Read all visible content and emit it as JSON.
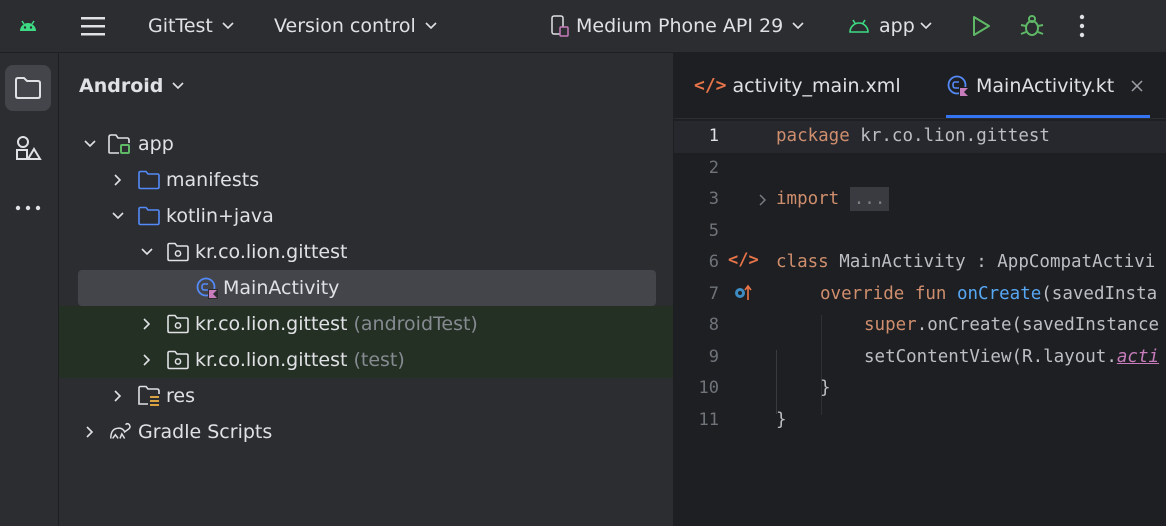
{
  "toolbar": {
    "project_name": "GitTest",
    "vcs_label": "Version control",
    "device": "Medium Phone API 29",
    "run_config": "app"
  },
  "colors": {
    "accent": "#3574f0",
    "run_green": "#5fb865",
    "android_green": "#3ddc84",
    "selection": "#43454a",
    "test_bg": "#253024"
  },
  "project_panel": {
    "view_mode": "Android",
    "tree": [
      {
        "label": "app",
        "suffix": "",
        "icon": "module-icon",
        "depth": 0,
        "expanded": true
      },
      {
        "label": "manifests",
        "suffix": "",
        "icon": "folder-icon",
        "depth": 1,
        "expanded": false
      },
      {
        "label": "kotlin+java",
        "suffix": "",
        "icon": "folder-icon",
        "depth": 1,
        "expanded": true
      },
      {
        "label": "kr.co.lion.gittest",
        "suffix": "",
        "icon": "package-icon",
        "depth": 2,
        "expanded": true
      },
      {
        "label": "MainActivity",
        "suffix": "",
        "icon": "kotlin-class-icon",
        "depth": 3,
        "selected": true
      },
      {
        "label": "kr.co.lion.gittest",
        "suffix": "(androidTest)",
        "icon": "package-icon",
        "depth": 2,
        "expanded": false
      },
      {
        "label": "kr.co.lion.gittest",
        "suffix": "(test)",
        "icon": "package-icon",
        "depth": 2,
        "expanded": false
      },
      {
        "label": "res",
        "suffix": "",
        "icon": "res-folder-icon",
        "depth": 1,
        "expanded": false
      },
      {
        "label": "Gradle Scripts",
        "suffix": "",
        "icon": "gradle-icon",
        "depth": 0,
        "expanded": false
      }
    ]
  },
  "editor": {
    "tabs": [
      {
        "label": "activity_main.xml",
        "active": false
      },
      {
        "label": "MainActivity.kt",
        "active": true
      }
    ],
    "line_numbers": [
      "1",
      "2",
      "3",
      "5",
      "6",
      "7",
      "8",
      "9",
      "10",
      "11"
    ],
    "code": {
      "l1_kw": "package",
      "l1_rest": " kr.co.lion.gittest",
      "l3_kw": "import",
      "l3_fold": "...",
      "l6_kw": "class",
      "l6_rest": " MainActivity : AppCompatActivi",
      "l7_kw": "override fun",
      "l7_fn": " onCreate",
      "l7_rest": "(savedInsta",
      "l8_kw": "super",
      "l8_rest": ".onCreate(savedInstance",
      "l9_rest": "setContentView(R.layout.",
      "l9_it": "acti",
      "l10": "}",
      "l11": "}"
    }
  }
}
